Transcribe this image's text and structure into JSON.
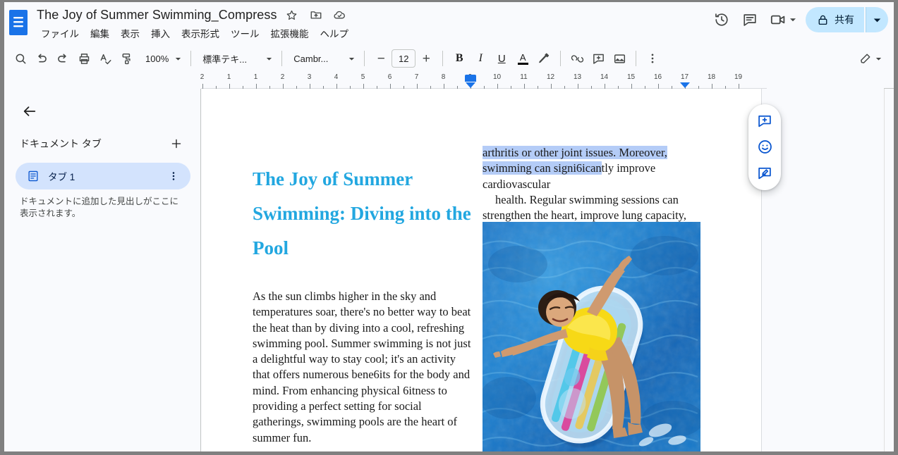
{
  "window": {
    "app": "Google Docs"
  },
  "header": {
    "doc_icon": "docs-file-icon",
    "title": "The Joy of Summer Swimming_Compress",
    "star_icon": "star-icon",
    "move_icon": "move-to-folder-icon",
    "cloud_icon": "cloud-saved-icon",
    "menus": [
      "ファイル",
      "編集",
      "表示",
      "挿入",
      "表示形式",
      "ツール",
      "拡張機能",
      "ヘルプ"
    ],
    "actions": {
      "history_icon": "version-history-icon",
      "comment_icon": "comment-history-icon",
      "meet_icon": "video-camera-icon",
      "meet_caret": "chevron-down-icon",
      "share_lock_icon": "lock-icon",
      "share_label": "共有",
      "share_caret": "chevron-down-icon"
    }
  },
  "toolbar": {
    "search_icon": "search-icon",
    "undo_icon": "undo-icon",
    "redo_icon": "redo-icon",
    "print_icon": "print-icon",
    "spellcheck_icon": "spellcheck-icon",
    "paint_format_icon": "paint-format-icon",
    "zoom_value": "100%",
    "zoom_caret": "chevron-down-icon",
    "style_value": "標準テキ...",
    "style_caret": "chevron-down-icon",
    "font_value": "Cambr...",
    "font_caret": "chevron-down-icon",
    "font_decrease": "−",
    "font_size": "12",
    "font_increase": "+",
    "bold_label": "B",
    "italic_label": "I",
    "underline_label": "U",
    "text_color_label": "A",
    "highlight_icon": "highlight-pen-icon",
    "link_icon": "insert-link-icon",
    "comment_icon": "add-comment-icon",
    "image_icon": "insert-image-icon",
    "more_icon": "more-vertical-icon",
    "edit_mode_icon": "edit-pencil-icon",
    "edit_mode_caret": "chevron-down-icon"
  },
  "ruler": {
    "labels": [
      "2",
      "1",
      "1",
      "2",
      "3",
      "4",
      "5",
      "6",
      "7",
      "8",
      "9",
      "10",
      "11",
      "12",
      "13",
      "14",
      "15",
      "16",
      "17",
      "18",
      "19"
    ],
    "left_margin_marker": "left-margin-marker",
    "first_line_indent_marker": "first-line-indent-marker",
    "right_indent_marker": "right-indent-marker"
  },
  "sidebar": {
    "back_icon": "back-arrow-icon",
    "heading": "ドキュメント タブ",
    "add_icon": "add-tab-icon",
    "tab": {
      "icon": "document-tab-icon",
      "label": "タブ 1",
      "more_icon": "more-vertical-icon"
    },
    "hint": "ドキュメントに追加した見出しがここに表示されます。"
  },
  "document": {
    "heading": "The Joy of Summer Swimming: Diving into the Pool",
    "left_paragraph": "As the sun climbs higher in the sky and temperatures soar, there's no better way to beat the heat than by diving into a cool, refreshing swimming pool. Summer swimming is not just a delightful way to stay cool; it's an activity that offers numerous bene6its for the body and mind. From enhancing physical 6itness to providing a perfect setting for social gatherings, swimming pools are the heart of summer fun.",
    "right_paragraph_selected": "arthritis  or other joint issues. Moreover, swimming  can signi6ican",
    "right_paragraph_unselected": "tly improve cardiovascular",
    "right_paragraph_2": "health. Regular swimming sessions can strengthen the heart, improve lung capacity,",
    "image_alt": "woman-floating-on-pool-raft-photo",
    "selection_color": "#b4ccf7",
    "heading_color": "#22a7e0"
  },
  "floating_rail": {
    "add_comment_icon": "add-comment-icon",
    "emoji_reaction_icon": "emoji-reaction-icon",
    "suggest_edit_icon": "suggest-edit-icon"
  }
}
